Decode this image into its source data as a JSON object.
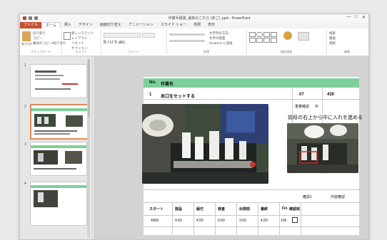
{
  "window": {
    "title": "作業手順書_最新のこれら (未ご) .pptx - PowerPoint",
    "controls": [
      "—",
      "□",
      "✕"
    ]
  },
  "ribbon_tabs": [
    "ファイル",
    "ホーム",
    "挿入",
    "デザイン",
    "画面切り替え",
    "アニメーション",
    "スライド ショー",
    "校閲",
    "表示"
  ],
  "ribbon": {
    "clipboard_label": "クリップボード",
    "paste_label": "貼り付け",
    "slides_label": "スライド",
    "font_label": "フォント",
    "paragraph_label": "段落",
    "drawing_label": "図形描画",
    "editing_label": "編集",
    "clipboard_items": [
      "切り取り",
      "コピー",
      "書式のコピー/貼り付け"
    ],
    "slide_items": [
      "新しいスライド",
      "レイアウト",
      "リセット",
      "セクション"
    ],
    "font_sample": "B I U S abc",
    "paragraph_items": [
      "文字列の方向",
      "文字の配置",
      "SmartArt に変換"
    ],
    "editing_items": [
      "検索",
      "置換",
      "選択"
    ]
  },
  "slide_pane": {
    "numbers": [
      "1",
      "2",
      "3",
      "4"
    ]
  },
  "slide": {
    "header_no": "No.",
    "header_title": "作業名",
    "step_no": "1",
    "step_text": "本口をセットする",
    "value_a": "07",
    "value_b": "430",
    "label_a": "重量確認",
    "label_b": "中",
    "caption_right": "前段の右上から中に入れを進める",
    "note_left": "確認1",
    "note_right": "内容確認",
    "table_headers": [
      "スタート",
      "部品",
      "組付",
      "検査",
      "出荷前",
      "最終",
      "Fin",
      "確認完"
    ],
    "table_values": [
      "4000",
      "4.50",
      "4.50",
      "0.50",
      "3.50",
      "4.50",
      "100"
    ]
  },
  "colors": {
    "accent_green": "#7ed09b",
    "file_tab": "#c8502f",
    "selected_thumb": "#e08b5a"
  }
}
